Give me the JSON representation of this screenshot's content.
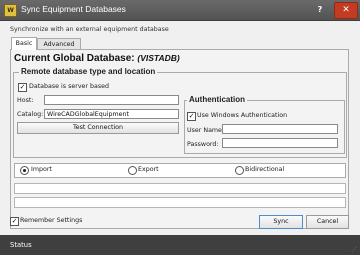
{
  "window": {
    "title": "Sync Equipment Databases",
    "icon_letter": "W",
    "help_label": "?",
    "close_label": "✕"
  },
  "subtitle": "Synchronize with an external equipment database",
  "tabs": [
    {
      "label": "Basic",
      "active": true
    },
    {
      "label": "Advanced",
      "active": false
    }
  ],
  "database": {
    "title_prefix": "Current Global Database:",
    "name": "(VISTADB)"
  },
  "remote": {
    "title": "Remote database type and location",
    "server_based_label": "Database is server based",
    "server_based_checked": true,
    "host_label": "Host:",
    "host_value": "",
    "catalog_label": "Catalog:",
    "catalog_value": "WireCADGlobalEquipment",
    "test_button": "Test Connection"
  },
  "auth": {
    "title": "Authentication",
    "windows_auth_label": "Use Windows Authentication",
    "windows_auth_checked": true,
    "username_label": "User Name:",
    "username_value": "",
    "password_label": "Password:",
    "password_value": ""
  },
  "sync_mode": {
    "options": [
      "Import",
      "Export",
      "Bidirectional"
    ],
    "selected": "Import"
  },
  "remember": {
    "label": "Remember Settings",
    "checked": true
  },
  "buttons": {
    "sync": "Sync",
    "cancel": "Cancel"
  },
  "status": {
    "text": "Status"
  }
}
